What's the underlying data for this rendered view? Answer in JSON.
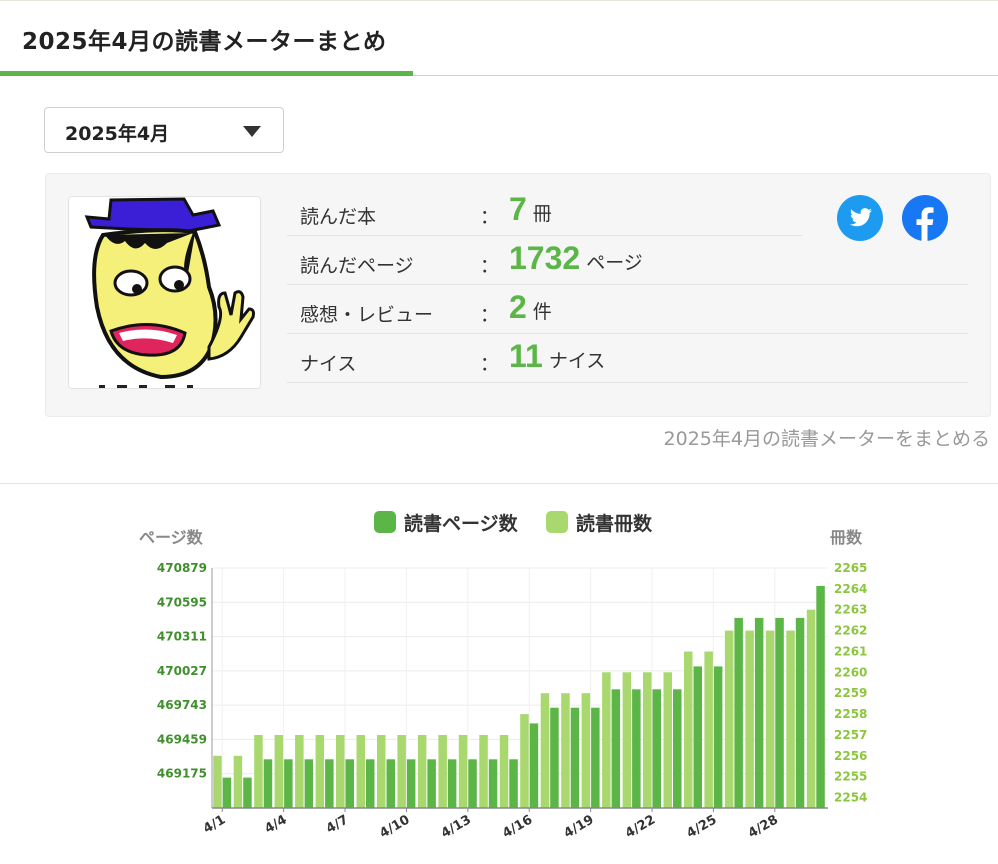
{
  "header": {
    "title": "2025年4月の読書メーターまとめ"
  },
  "month_select": {
    "value": "2025年4月",
    "icon": "triangle-down-icon"
  },
  "summary": {
    "stats": [
      {
        "label": "読んだ本",
        "colon": "：",
        "value": "7",
        "unit": "冊"
      },
      {
        "label": "読んだページ",
        "colon": "：",
        "value": "1732",
        "unit": "ページ"
      },
      {
        "label": "感想・レビュー",
        "colon": "：",
        "value": "2",
        "unit": "件"
      },
      {
        "label": "ナイス",
        "colon": "：",
        "value": "11",
        "unit": "ナイス"
      }
    ],
    "accent_color": "#5cb547",
    "sns": {
      "twitter_icon": "twitter-icon",
      "facebook_icon": "facebook-icon",
      "twitter_color": "#1d9bf0",
      "facebook_color": "#1877f2"
    }
  },
  "summary_link": "2025年4月の読書メーターをまとめる",
  "chart_data": {
    "type": "bar",
    "legend": [
      "読書ページ数",
      "読書冊数"
    ],
    "legend_position": "top-center",
    "y_left_label": "ページ数",
    "y_right_label": "冊数",
    "y_left_ticks": [
      "470879",
      "470595",
      "470311",
      "470027",
      "469743",
      "469459",
      "469175"
    ],
    "y_right_ticks": [
      "2265",
      "2264",
      "2263",
      "2262",
      "2261",
      "2260",
      "2259",
      "2258",
      "2257",
      "2256",
      "2255",
      "2254"
    ],
    "y_left_range": [
      468891,
      470879
    ],
    "y_right_range": [
      2253.5,
      2265
    ],
    "x_tick_labels": [
      "4/1",
      "4/4",
      "4/7",
      "4/10",
      "4/13",
      "4/16",
      "4/19",
      "4/22",
      "4/25",
      "4/28"
    ],
    "x": [
      "4/1",
      "4/2",
      "4/3",
      "4/4",
      "4/5",
      "4/6",
      "4/7",
      "4/8",
      "4/9",
      "4/10",
      "4/11",
      "4/12",
      "4/13",
      "4/14",
      "4/15",
      "4/16",
      "4/17",
      "4/18",
      "4/19",
      "4/20",
      "4/21",
      "4/22",
      "4/23",
      "4/24",
      "4/25",
      "4/26",
      "4/27",
      "4/28",
      "4/29",
      "4/30"
    ],
    "series": [
      {
        "name": "読書ページ数",
        "axis": "left",
        "color": "#5cb547",
        "values": [
          469143,
          469143,
          469294,
          469294,
          469294,
          469294,
          469294,
          469294,
          469294,
          469294,
          469294,
          469294,
          469294,
          469294,
          469294,
          469592,
          469722,
          469722,
          469722,
          469874,
          469874,
          469874,
          469874,
          470064,
          470064,
          470466,
          470466,
          470466,
          470466,
          470731
        ]
      },
      {
        "name": "読書冊数",
        "axis": "right",
        "color": "#a8d86e",
        "values": [
          2256,
          2256,
          2257,
          2257,
          2257,
          2257,
          2257,
          2257,
          2257,
          2257,
          2257,
          2257,
          2257,
          2257,
          2257,
          2258,
          2259,
          2259,
          2259,
          2260,
          2260,
          2260,
          2260,
          2261,
          2261,
          2262,
          2262,
          2262,
          2262,
          2263
        ]
      }
    ],
    "grid": true
  }
}
